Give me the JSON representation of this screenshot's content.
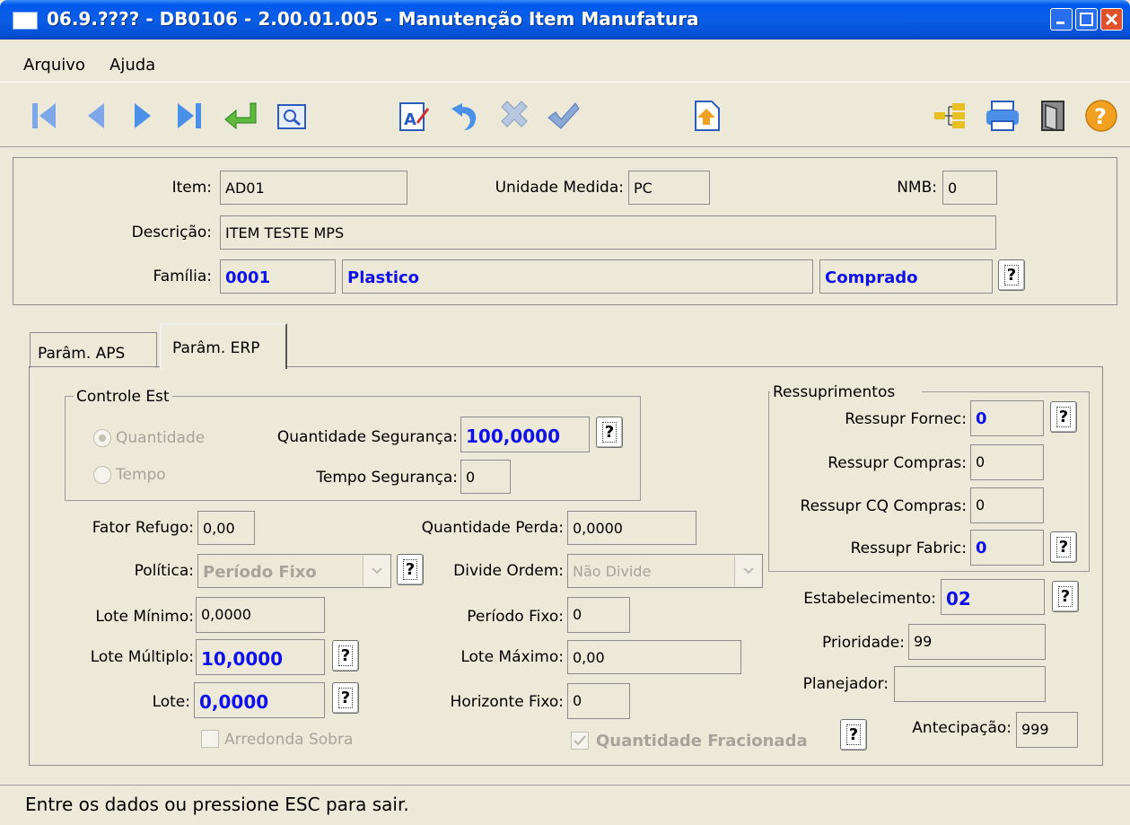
{
  "window": {
    "title": "06.9.???? - DB0106 - 2.00.01.005 - Manutenção Item Manufatura"
  },
  "menu": {
    "items": [
      "Arquivo",
      "Ajuda"
    ]
  },
  "toolbar": {
    "icons": [
      "first-record-icon",
      "previous-record-icon",
      "next-record-icon",
      "last-record-icon",
      "goto-icon",
      "search-icon",
      "edit-icon",
      "undo-icon",
      "delete-icon",
      "confirm-icon",
      "import-icon",
      "tree-icon",
      "print-icon",
      "exit-icon",
      "help-icon"
    ]
  },
  "header": {
    "item_label": "Item:",
    "item_value": "AD01",
    "unidade_label": "Unidade Medida:",
    "unidade_value": "PC",
    "nmb_label": "NMB:",
    "nmb_value": "0",
    "descricao_label": "Descrição:",
    "descricao_value": "ITEM TESTE MPS",
    "familia_label": "Família:",
    "familia_code": "0001",
    "familia_desc": "Plastico",
    "familia_tipo": "Comprado"
  },
  "tabs": [
    {
      "label": "Parâm. APS"
    },
    {
      "label": "Parâm. ERP"
    }
  ],
  "controle_est": {
    "title": "Controle Est",
    "radio_quantidade": "Quantidade",
    "radio_tempo": "Tempo",
    "qtd_seg_label": "Quantidade Segurança:",
    "qtd_seg_value": "100,0000",
    "tempo_seg_label": "Tempo Segurança:",
    "tempo_seg_value": "0"
  },
  "form": {
    "fator_refugo_label": "Fator Refugo:",
    "fator_refugo_value": "0,00",
    "qtd_perda_label": "Quantidade Perda:",
    "qtd_perda_value": "0,0000",
    "politica_label": "Política:",
    "politica_value": "Período Fixo",
    "divide_ordem_label": "Divide Ordem:",
    "divide_ordem_value": "Não Divide",
    "lote_minimo_label": "Lote Mínimo:",
    "lote_minimo_value": "0,0000",
    "periodo_fixo_label": "Período Fixo:",
    "periodo_fixo_value": "0",
    "lote_multiplo_label": "Lote Múltiplo:",
    "lote_multiplo_value": "10,0000",
    "lote_maximo_label": "Lote Máximo:",
    "lote_maximo_value": "0,00",
    "lote_label": "Lote:",
    "lote_value": "0,0000",
    "horizonte_fixo_label": "Horizonte Fixo:",
    "horizonte_fixo_value": "0",
    "arredonda_sobra_label": "Arredonda Sobra",
    "qtd_fracionada_label": "Quantidade Fracionada"
  },
  "ressuprimentos": {
    "title": "Ressuprimentos",
    "fornec_label": "Ressupr Fornec:",
    "fornec_value": "0",
    "compras_label": "Ressupr Compras:",
    "compras_value": "0",
    "cq_compras_label": "Ressupr CQ Compras:",
    "cq_compras_value": "0",
    "fabric_label": "Ressupr Fabric:",
    "fabric_value": "0"
  },
  "side": {
    "estabelecimento_label": "Estabelecimento:",
    "estabelecimento_value": "02",
    "prioridade_label": "Prioridade:",
    "prioridade_value": "99",
    "planejador_label": "Planejador:",
    "planejador_value": "",
    "antecipacao_label": "Antecipação:",
    "antecipacao_value": "999"
  },
  "help_button_label": "?",
  "status": {
    "message": "Entre os dados ou pressione ESC para sair."
  },
  "colors": {
    "title_bar": "#0A5EE6",
    "window_bg": "#ECE9D8",
    "emphasis_text": "#1010E8"
  }
}
